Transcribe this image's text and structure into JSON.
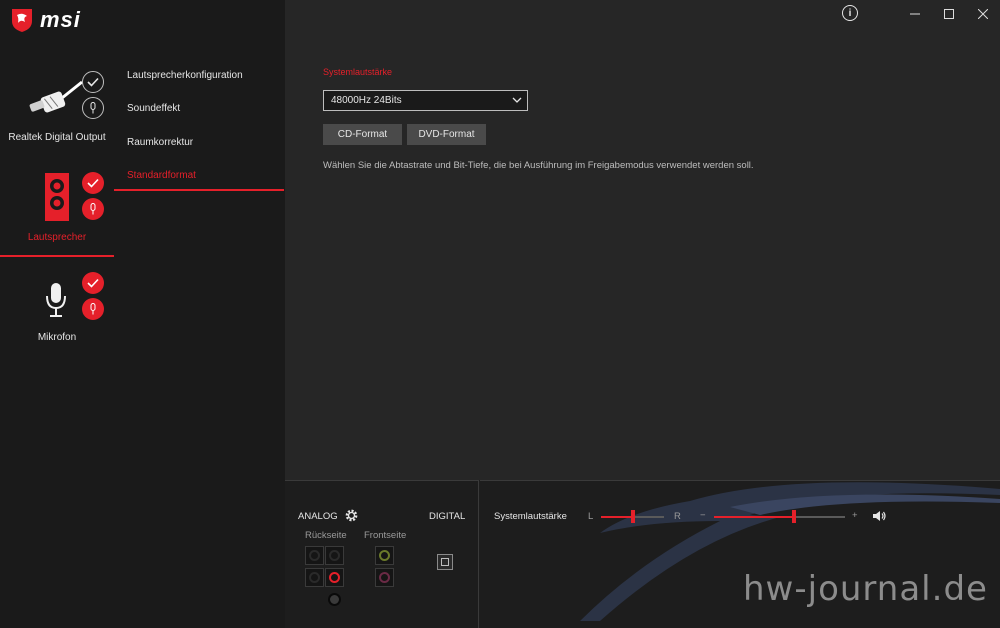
{
  "app": {
    "brand": "msi"
  },
  "devices": [
    {
      "label": "Realtek Digital Output"
    },
    {
      "label": "Lautsprecher"
    },
    {
      "label": "Mikrofon"
    }
  ],
  "nav": {
    "items": [
      "Lautsprecherkonfiguration",
      "Soundeffekt",
      "Raumkorrektur",
      "Standardformat"
    ],
    "active": "Standardformat"
  },
  "main": {
    "section_title": "Systemlautstärke",
    "format_select": {
      "value": "48000Hz 24Bits"
    },
    "buttons": {
      "cd": "CD-Format",
      "dvd": "DVD-Format"
    },
    "description": "Wählen Sie die Abtastrate und Bit-Tiefe, die bei Ausführung im Freigabemodus verwendet werden soll."
  },
  "bottom": {
    "analog_label": "ANALOG",
    "digital_label": "DIGITAL",
    "rear_label": "Rückseite",
    "front_label": "Frontseite",
    "volume_label": "Systemlautstärke",
    "balance_left": "L",
    "balance_right": "R",
    "minus": "−",
    "plus": "+",
    "balance_level": 0.5,
    "volume_level": 0.61
  },
  "watermark": "hw-journal.de",
  "colors": {
    "accent": "#e5202a",
    "background": "#262626",
    "sidebar": "#1a1a1a"
  }
}
